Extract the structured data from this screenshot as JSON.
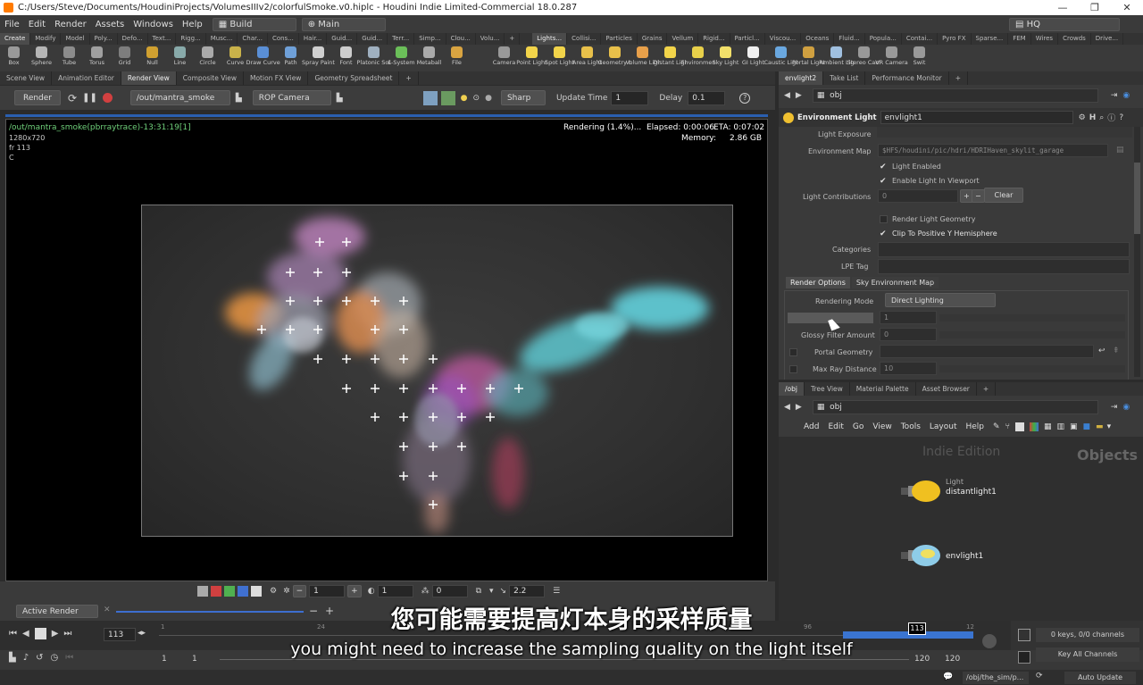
{
  "title_bar": {
    "path": "C:/Users/Steve/Documents/HoudiniProjects/VolumesIIIv2/colorfulSmoke.v0.hiplc - Houdini Indie Limited-Commercial 18.0.287"
  },
  "menu": {
    "items": [
      "File",
      "Edit",
      "Render",
      "Assets",
      "Windows",
      "Help"
    ],
    "desktop": "Build",
    "main": "Main",
    "hq": "HQ"
  },
  "shelf_tabs_left": [
    "Create",
    "Modify",
    "Model",
    "Poly...",
    "Defo...",
    "Text...",
    "Rigg...",
    "Musc...",
    "Char...",
    "Cons...",
    "Hair...",
    "Guid...",
    "Guid...",
    "Terr...",
    "Simp...",
    "Clou...",
    "Volu..."
  ],
  "shelf_tabs_right": [
    "Lights...",
    "Collisi...",
    "Particles",
    "Grains",
    "Vellum",
    "Rigid...",
    "Particl...",
    "Viscou...",
    "Oceans",
    "Fluid...",
    "Popula...",
    "Contai...",
    "Pyro FX",
    "Sparse...",
    "FEM",
    "Wires",
    "Crowds",
    "Drive..."
  ],
  "tools_left": [
    {
      "label": "Box",
      "color": "#9a9a9a"
    },
    {
      "label": "Sphere",
      "color": "#b5b5b5"
    },
    {
      "label": "Tube",
      "color": "#8c8c8c"
    },
    {
      "label": "Torus",
      "color": "#a0a0a0"
    },
    {
      "label": "Grid",
      "color": "#7d7d7d"
    },
    {
      "label": "Null",
      "color": "#d0a030"
    },
    {
      "label": "Line",
      "color": "#8aa"
    },
    {
      "label": "Circle",
      "color": "#aaa"
    },
    {
      "label": "Curve",
      "color": "#c9b24a"
    },
    {
      "label": "Draw Curve",
      "color": "#5a8fd6"
    },
    {
      "label": "Path",
      "color": "#6fa0d8"
    },
    {
      "label": "Spray Paint",
      "color": "#d0d0d0"
    },
    {
      "label": "Font",
      "color": "#cccccc"
    },
    {
      "label": "Platonic Solids",
      "color": "#9fb0c0"
    },
    {
      "label": "L-System",
      "color": "#6bbf59"
    },
    {
      "label": "Metaball",
      "color": "#aaa"
    },
    {
      "label": "File",
      "color": "#d9a441"
    }
  ],
  "tools_right": [
    {
      "label": "Camera",
      "color": "#999"
    },
    {
      "label": "Point Light",
      "color": "#f2d44a"
    },
    {
      "label": "Spot Light",
      "color": "#f2d44a"
    },
    {
      "label": "Area Light",
      "color": "#e8c04a"
    },
    {
      "label": "Geometry Light",
      "color": "#e8c04a"
    },
    {
      "label": "Volume Light",
      "color": "#e8a04a"
    },
    {
      "label": "Distant Light",
      "color": "#f2d44a"
    },
    {
      "label": "Environment Light",
      "color": "#e8d04a"
    },
    {
      "label": "Sky Light",
      "color": "#f2e06a"
    },
    {
      "label": "GI Light",
      "color": "#f0f0f0"
    },
    {
      "label": "Caustic Light",
      "color": "#6aa8e0"
    },
    {
      "label": "Portal Light",
      "color": "#d0a040"
    },
    {
      "label": "Ambient Light",
      "color": "#a0c0e0"
    },
    {
      "label": "Stereo Camera",
      "color": "#999"
    },
    {
      "label": "VR Camera",
      "color": "#999"
    },
    {
      "label": "Swit",
      "color": "#999"
    }
  ],
  "left_pane_tabs": [
    "Scene View",
    "Animation Editor",
    "Render View",
    "Composite View",
    "Motion FX View",
    "Geometry Spreadsheet"
  ],
  "render_toolbar": {
    "render_label": "Render",
    "rop": "/out/mantra_smoke",
    "camera": "ROP Camera",
    "preview": "Sharp",
    "update_time_label": "Update Time",
    "update_time": "1",
    "delay_label": "Delay",
    "delay": "0.1"
  },
  "render_overlay": {
    "name": "/out/mantra_smoke(pbrraytrace)-13:31:19[1]",
    "resolution": "1280x720",
    "frame": "fr 113",
    "channel": "C",
    "status": "Rendering (1.4%)...",
    "elapsed": "Elapsed: 0:00:06",
    "eta": "ETA: 0:07:02",
    "memory_label": "Memory:",
    "memory": "2.86 GB"
  },
  "viewer_bottom": {
    "val1": "1",
    "val2": "1",
    "val3": "0",
    "gamma": "2.2"
  },
  "active_render": "Active Render",
  "right_tabs": [
    "envlight2",
    "Take List",
    "Performance Monitor"
  ],
  "path_obj": "obj",
  "node_header": {
    "type": "Environment Light",
    "name": "envlight1"
  },
  "params": {
    "light_exposure": "Light Exposure",
    "environment_map": "Environment Map",
    "environment_map_value": "$HFS/houdini/pic/hdri/HDRIHaven_skylit_garage",
    "light_enabled": "Light Enabled",
    "enable_in_viewport": "Enable Light In Viewport",
    "light_contributions": "Light Contributions",
    "light_contributions_value": "0",
    "clear": "Clear",
    "render_light_geometry": "Render Light Geometry",
    "clip_y": "Clip To Positive Y Hemisphere",
    "categories": "Categories",
    "lpe_tag": "LPE Tag",
    "tab_render_options": "Render Options",
    "tab_sky_env": "Sky Environment Map",
    "rendering_mode": "Rendering Mode",
    "rendering_mode_value": "Direct Lighting",
    "samples_value": "1",
    "glossy_filter": "Glossy Filter Amount",
    "glossy_filter_value": "0",
    "portal_geometry": "Portal Geometry",
    "max_ray_distance": "Max Ray Distance",
    "max_ray_distance_value": "10"
  },
  "net_tabs": [
    "/obj",
    "Tree View",
    "Material Palette",
    "Asset Browser"
  ],
  "net_menu": [
    "Add",
    "Edit",
    "Go",
    "View",
    "Tools",
    "Layout",
    "Help"
  ],
  "network": {
    "watermark": "Indie Edition",
    "context": "Objects",
    "node1_type": "Light",
    "node1_name": "distantlight1",
    "node2_name": "envlight1"
  },
  "timeline": {
    "frame": "113",
    "start": "1",
    "start2": "1",
    "end": "120",
    "end2": "120",
    "current": "113",
    "marks": [
      "1",
      "24",
      "96",
      "12"
    ],
    "keys": "0 keys, 0/0 channels",
    "key_all": "Key All Channels",
    "path": "/obj/the_sim/p...",
    "auto_update": "Auto Update"
  },
  "subtitles": {
    "cn": "您可能需要提高灯本身的采样质量",
    "en": "you might need to increase the sampling quality on the light itself"
  }
}
